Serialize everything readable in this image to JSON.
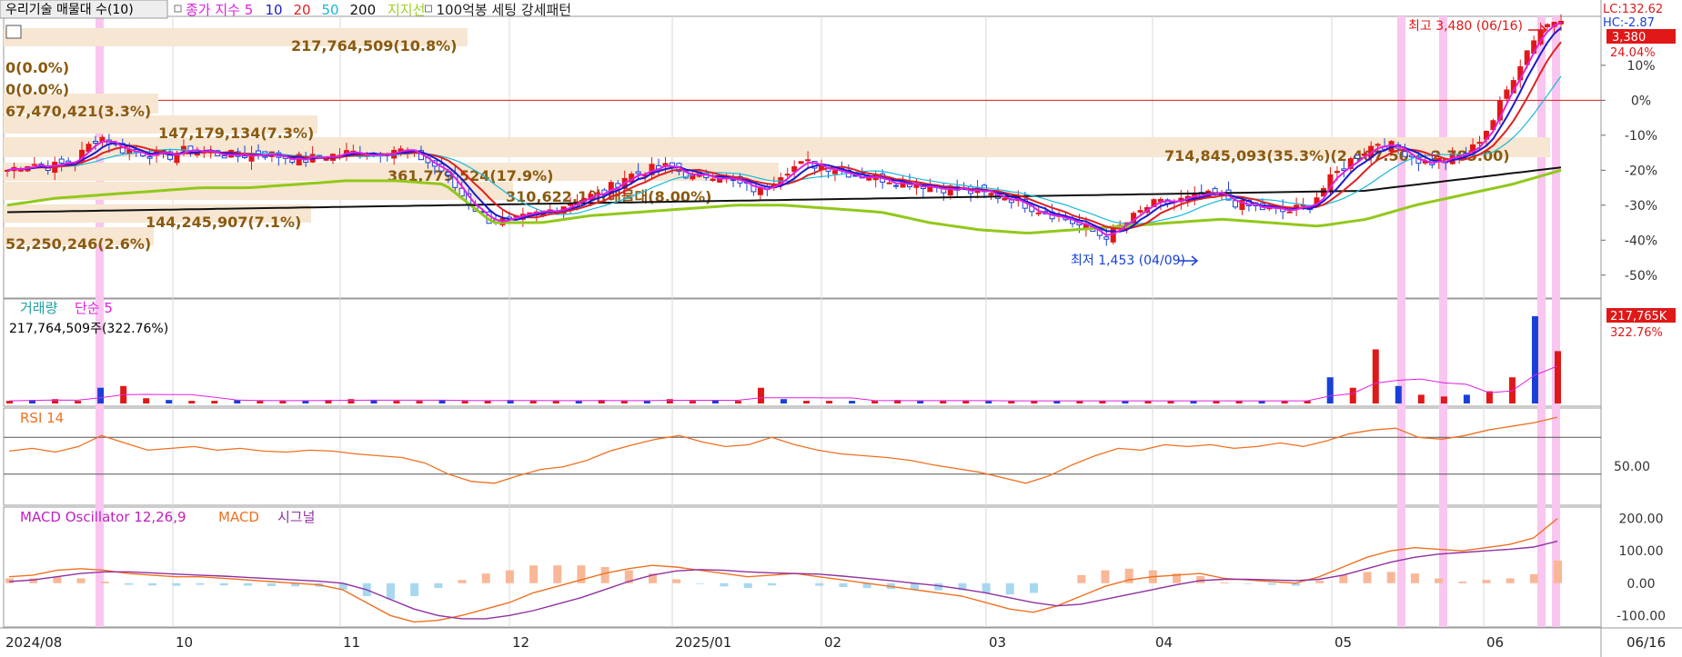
{
  "header": {
    "stock_button": "우리기술 매물대 수(10)",
    "legend": [
      {
        "text": "종가 지수 5",
        "color": "#e020e0"
      },
      {
        "text": "10",
        "color": "#1a1ad0"
      },
      {
        "text": "20",
        "color": "#e02020"
      },
      {
        "text": "50",
        "color": "#18b8d8"
      },
      {
        "text": "200",
        "color": "#111111"
      },
      {
        "text": "지지선",
        "color": "#9cd020"
      },
      {
        "text": "100억봉 세팅 강세패턴",
        "color": "#222222"
      }
    ]
  },
  "colors": {
    "up": "#e01818",
    "down": "#1840d8",
    "ma5": "#e020e0",
    "ma10": "#1a1ad0",
    "ma20": "#e02020",
    "ma50": "#18b8d8",
    "ma200": "#111111",
    "support": "#92c81a",
    "highlight": "#f9c6f0",
    "profile": "#f6e6d2",
    "profile_text": "#8a5a10",
    "rsi": "#f07020",
    "macd": "#f07020",
    "signal": "#9030a0",
    "osc_up": "#f8b898",
    "osc_down": "#a8d8f0"
  },
  "price_panel": {
    "max_label": "최고 3,480 (06/16)",
    "min_label": "최저 1,453 (04/09)",
    "lc_label": "LC:132.62",
    "hc_label": "HC:-2.87",
    "current_tag": "3,380",
    "current_pct": "24.04%",
    "pct_ticks": [
      "10%",
      "0%",
      "-10%",
      "-20%",
      "-30%",
      "-40%",
      "-50%"
    ],
    "volume_profile": [
      {
        "label": "217,764,509(10.8%)"
      },
      {
        "label": "0(0.0%)"
      },
      {
        "label": "0(0.0%)"
      },
      {
        "label": "67,470,421(3.3%)"
      },
      {
        "label": "147,179,134(7.3%)"
      },
      {
        "label": "714,845,093(35.3%)(2,467.50 ~ 2,785.00)"
      },
      {
        "label": "361,779,524(17.9%)"
      },
      {
        "label": "310,622,1이(매물대(8.00%)"
      },
      {
        "label": "144,245,907(7.1%)"
      },
      {
        "label": "52,250,246(2.6%)"
      }
    ]
  },
  "volume_panel": {
    "title": "거래량",
    "ma_label": "단순 5",
    "value_label": "217,764,509주(322.76%)",
    "tag": "217,765K",
    "tag_pct": "322.76%"
  },
  "rsi_panel": {
    "title": "RSI 14",
    "tick": "50.00"
  },
  "macd_panel": {
    "title": "MACD Oscillator 12,26,9",
    "macd_label": "MACD",
    "signal_label": "시그널",
    "ticks": [
      "200.00",
      "100.00",
      "0.00",
      "-100.00"
    ]
  },
  "x_axis": {
    "labels": [
      "2024/08",
      "10",
      "11",
      "12",
      "2025/01",
      "02",
      "03",
      "04",
      "05",
      "06",
      "06/16"
    ]
  },
  "chart_data": {
    "type": "candlestick",
    "x": [
      "2024/08",
      "10",
      "11",
      "12",
      "2025/01",
      "02",
      "03",
      "04",
      "05",
      "06",
      "06/16"
    ],
    "price_high": 3480,
    "price_high_date": "06/16",
    "price_low": 1453,
    "price_low_date": "04/09",
    "last_close": 3380,
    "last_change_pct": 24.04,
    "ref_line_pct": 0,
    "y_pct_range": [
      -55,
      24
    ],
    "close_pct_path": [
      -20,
      -18,
      -19,
      -17,
      -10,
      -14,
      -15,
      -16,
      -14,
      -15,
      -16,
      -15,
      -16,
      -17,
      -16,
      -15,
      -15,
      -14,
      -16,
      -20,
      -28,
      -34,
      -35,
      -33,
      -31,
      -28,
      -27,
      -22,
      -20,
      -19,
      -22,
      -21,
      -24,
      -26,
      -20,
      -18,
      -19,
      -21,
      -22,
      -23,
      -24,
      -25,
      -26,
      -27,
      -28,
      -31,
      -33,
      -36,
      -39,
      -35,
      -30,
      -29,
      -28,
      -27,
      -30,
      -31,
      -32,
      -30,
      -22,
      -16,
      -12,
      -14,
      -18,
      -17,
      -15,
      -6,
      8,
      20,
      24
    ],
    "volume_profile_pct": [
      10.8,
      0.0,
      0.0,
      3.3,
      7.3,
      35.3,
      17.9,
      8.0,
      7.1,
      2.6
    ],
    "volume_pct_of_max": [
      3,
      4,
      5,
      3,
      18,
      20,
      6,
      4,
      3,
      3,
      4,
      3,
      3,
      3,
      4,
      5,
      4,
      3,
      3,
      4,
      3,
      3,
      4,
      3,
      3,
      3,
      4,
      3,
      3,
      5,
      3,
      4,
      3,
      18,
      5,
      3,
      3,
      3,
      3,
      4,
      3,
      3,
      3,
      3,
      3,
      3,
      3,
      3,
      3,
      3,
      3,
      3,
      3,
      3,
      3,
      3,
      3,
      3,
      30,
      18,
      62,
      20,
      10,
      8,
      10,
      14,
      30,
      100,
      60
    ],
    "rsi_range": [
      0,
      100
    ],
    "rsi": [
      55,
      58,
      54,
      60,
      72,
      64,
      56,
      58,
      60,
      56,
      58,
      55,
      54,
      56,
      55,
      52,
      50,
      48,
      42,
      30,
      22,
      20,
      28,
      35,
      38,
      45,
      55,
      62,
      68,
      72,
      65,
      60,
      62,
      70,
      62,
      56,
      52,
      50,
      48,
      45,
      40,
      36,
      32,
      26,
      20,
      28,
      40,
      50,
      58,
      56,
      62,
      60,
      62,
      58,
      60,
      64,
      60,
      66,
      74,
      78,
      80,
      70,
      68,
      72,
      78,
      82,
      86,
      92
    ],
    "macd_range": [
      -130,
      230
    ],
    "macd": [
      20,
      25,
      40,
      45,
      40,
      30,
      25,
      20,
      20,
      15,
      10,
      5,
      0,
      -5,
      -20,
      -60,
      -100,
      -120,
      -115,
      -100,
      -80,
      -60,
      -30,
      -10,
      10,
      30,
      45,
      55,
      50,
      40,
      30,
      20,
      25,
      30,
      20,
      10,
      0,
      -10,
      -20,
      -30,
      -40,
      -60,
      -80,
      -90,
      -70,
      -40,
      -10,
      10,
      20,
      25,
      30,
      15,
      10,
      5,
      0,
      20,
      50,
      80,
      100,
      110,
      105,
      100,
      110,
      120,
      140,
      200
    ],
    "signal": [
      5,
      10,
      20,
      30,
      35,
      35,
      32,
      28,
      25,
      22,
      18,
      14,
      10,
      6,
      0,
      -20,
      -50,
      -80,
      -100,
      -110,
      -110,
      -100,
      -85,
      -65,
      -45,
      -20,
      5,
      25,
      38,
      42,
      40,
      35,
      32,
      30,
      28,
      22,
      15,
      8,
      0,
      -8,
      -18,
      -30,
      -45,
      -60,
      -70,
      -65,
      -50,
      -35,
      -20,
      -5,
      8,
      12,
      12,
      10,
      8,
      12,
      25,
      45,
      65,
      80,
      90,
      95,
      100,
      105,
      112,
      130
    ]
  }
}
